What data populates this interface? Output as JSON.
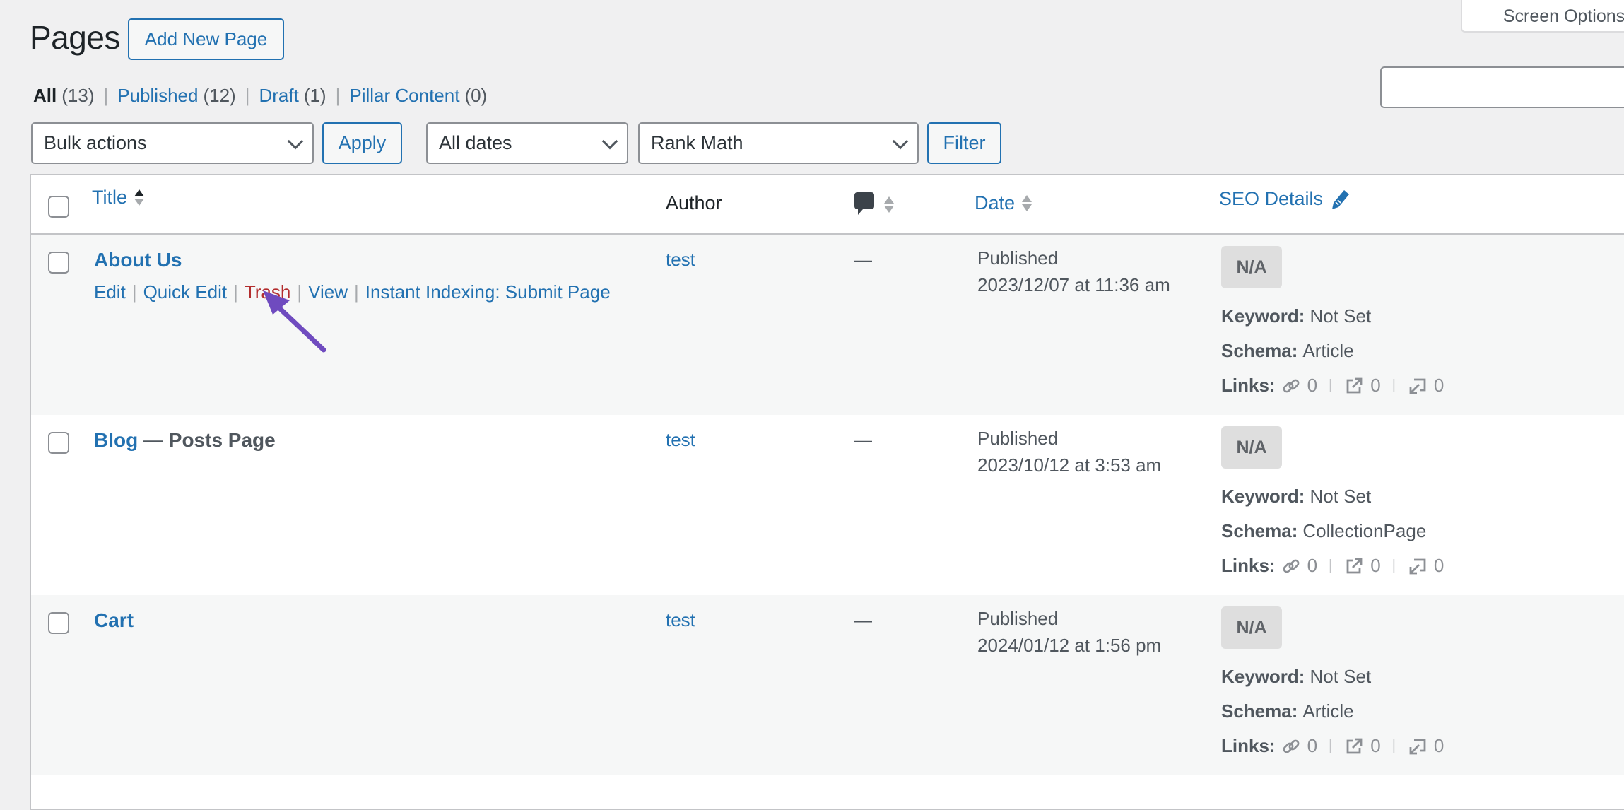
{
  "header": {
    "title": "Pages",
    "add_new_label": "Add New Page",
    "screen_options_label": "Screen Options"
  },
  "views": [
    {
      "label": "All",
      "count": "(13)",
      "current": true
    },
    {
      "label": "Published",
      "count": "(12)",
      "current": false
    },
    {
      "label": "Draft",
      "count": "(1)",
      "current": false
    },
    {
      "label": "Pillar Content",
      "count": "(0)",
      "current": false
    }
  ],
  "search": {
    "value": "",
    "placeholder": ""
  },
  "filters": {
    "bulk_actions": "Bulk actions",
    "apply_label": "Apply",
    "dates": "All dates",
    "seo_filter": "Rank Math",
    "filter_label": "Filter"
  },
  "table": {
    "columns": {
      "title": "Title",
      "author": "Author",
      "comments_icon": "comment-icon",
      "date": "Date",
      "seo": "SEO Details",
      "seo_icon": "pencil-icon"
    },
    "row_actions": {
      "edit": "Edit",
      "quick_edit": "Quick Edit",
      "trash": "Trash",
      "view": "View",
      "instant_indexing": "Instant Indexing: Submit Page"
    },
    "rows": [
      {
        "title": "About Us",
        "state": "",
        "author": "test",
        "comments": "—",
        "status": "Published",
        "date": "2023/12/07 at 11:36 am",
        "score": "N/A",
        "keyword_label": "Keyword:",
        "keyword": "Not Set",
        "schema_label": "Schema:",
        "schema": "Article",
        "links_label": "Links:",
        "internal": "0",
        "external": "0",
        "incoming": "0"
      },
      {
        "title": "Blog",
        "state": "— Posts Page",
        "author": "test",
        "comments": "—",
        "status": "Published",
        "date": "2023/10/12 at 3:53 am",
        "score": "N/A",
        "keyword_label": "Keyword:",
        "keyword": "Not Set",
        "schema_label": "Schema:",
        "schema": "CollectionPage",
        "links_label": "Links:",
        "internal": "0",
        "external": "0",
        "incoming": "0"
      },
      {
        "title": "Cart",
        "state": "",
        "author": "test",
        "comments": "—",
        "status": "Published",
        "date": "2024/01/12 at 1:56 pm",
        "score": "N/A",
        "keyword_label": "Keyword:",
        "keyword": "Not Set",
        "schema_label": "Schema:",
        "schema": "Article",
        "links_label": "Links:",
        "internal": "0",
        "external": "0",
        "incoming": "0"
      }
    ]
  },
  "annotation": {
    "color": "#6f4bbf",
    "points_to": "Trash"
  },
  "colors": {
    "link": "#2271b1",
    "trash": "#b32d2e",
    "background": "#f0f0f1"
  }
}
